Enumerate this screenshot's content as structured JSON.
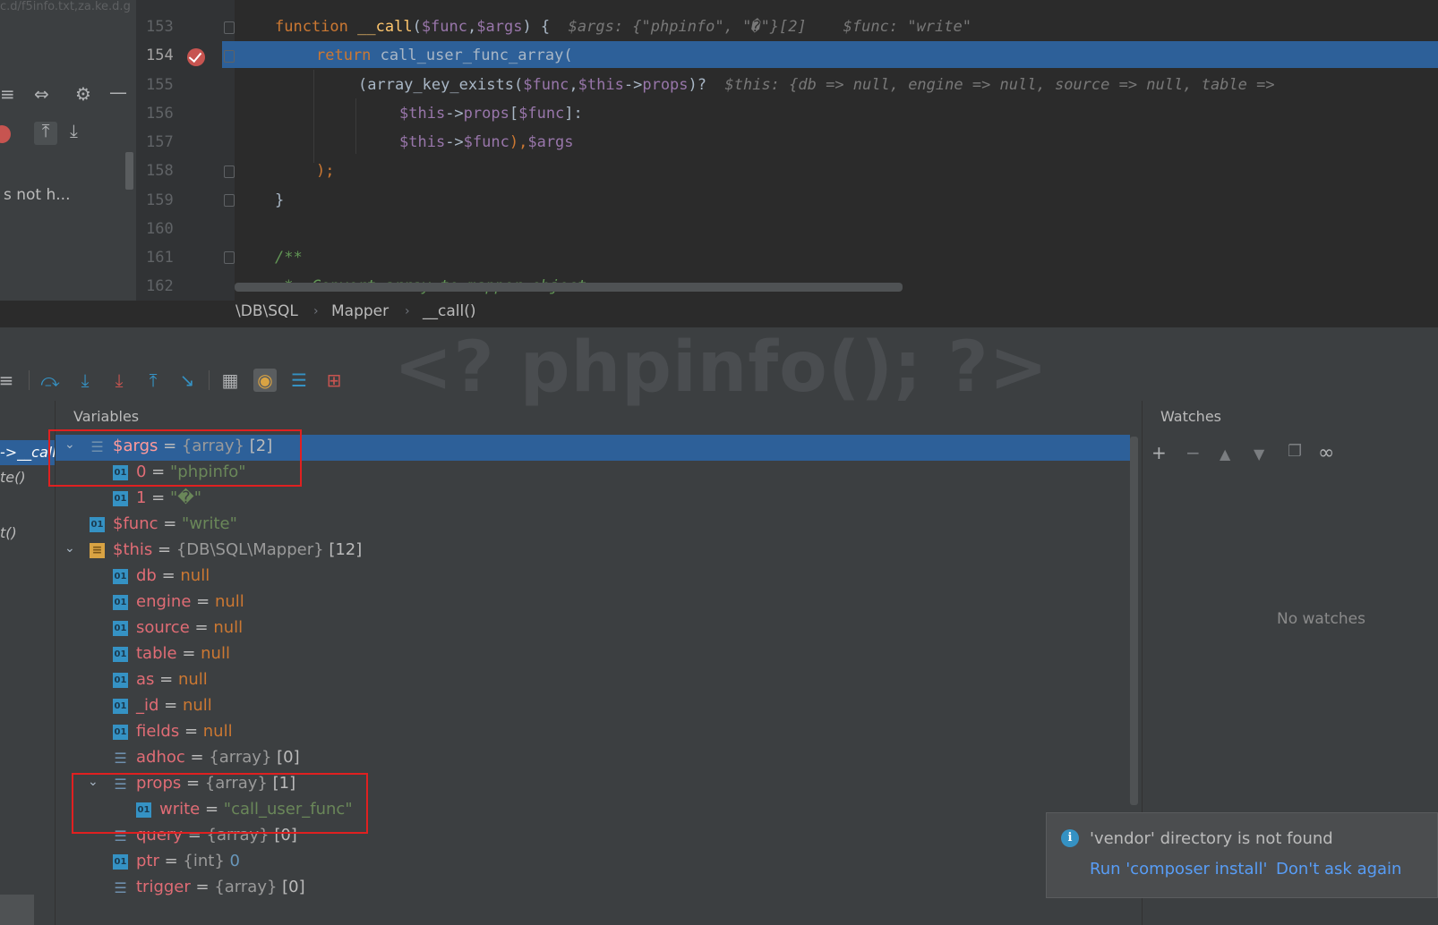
{
  "editor": {
    "lines": [
      {
        "num": "153"
      },
      {
        "num": "154"
      },
      {
        "num": "155"
      },
      {
        "num": "156"
      },
      {
        "num": "157"
      },
      {
        "num": "158"
      },
      {
        "num": "159"
      },
      {
        "num": "160"
      },
      {
        "num": "161"
      },
      {
        "num": "162"
      }
    ],
    "code": {
      "l153_kw": "function",
      "l153_fn": "__call",
      "l153_p1": "(",
      "l153_v1": "$func",
      "l153_p2": ",",
      "l153_v2": "$args",
      "l153_p3": ") {",
      "l153_hint": "$args: {\"phpinfo\", \"�\"}[2]    $func: \"write\"",
      "l154_kw": "return",
      "l154_rest": "call_user_func_array(",
      "l155_a": "(array_key_exists(",
      "l155_v1": "$func",
      "l155_b": ",",
      "l155_v2": "$this",
      "l155_c": "->",
      "l155_v3": "props",
      "l155_d": ")?",
      "l155_hint": "$this: {db => null, engine => null, source => null, table =>",
      "l156_v1": "$this",
      "l156_a": "->",
      "l156_v2": "props",
      "l156_b": "[",
      "l156_v3": "$func",
      "l156_c": "]:",
      "l157_v1": "$this",
      "l157_a": "->",
      "l157_v2": "$func",
      "l157_b": "),",
      "l157_v3": "$args",
      "l158": ");",
      "l159": "}",
      "l161": "/**",
      "l162": " *  Convert array to mapper object"
    }
  },
  "left_panel": {
    "path_fragment": "c.d/f5info.txt,za.ke.d.g",
    "hint": "s not h..."
  },
  "breadcrumb": [
    "\\DB\\SQL",
    "Mapper",
    "__call()"
  ],
  "debug": {
    "watermark": "<? phpinfo(); ?>",
    "frames": [
      "->__call",
      "te()",
      "t()"
    ],
    "variables_title": "Variables",
    "watches_title": "Watches",
    "no_watches": "No watches",
    "vars": [
      {
        "name": "$args",
        "eq": " = ",
        "type": "{array}",
        "count": " [2]"
      },
      {
        "name": "0",
        "eq": " = ",
        "value": "\"phpinfo\""
      },
      {
        "name": "1",
        "eq": " = ",
        "value": "\"�\""
      },
      {
        "name": "$func",
        "eq": " = ",
        "value": "\"write\""
      },
      {
        "name": "$this",
        "eq": " = ",
        "type": "{DB\\SQL\\Mapper}",
        "count": " [12]"
      },
      {
        "name": "db",
        "eq": " = ",
        "value": "null"
      },
      {
        "name": "engine",
        "eq": " = ",
        "value": "null"
      },
      {
        "name": "source",
        "eq": " = ",
        "value": "null"
      },
      {
        "name": "table",
        "eq": " = ",
        "value": "null"
      },
      {
        "name": "as",
        "eq": " = ",
        "value": "null"
      },
      {
        "name": "_id",
        "eq": " = ",
        "value": "null"
      },
      {
        "name": "fields",
        "eq": " = ",
        "value": "null"
      },
      {
        "name": "adhoc",
        "eq": " = ",
        "type": "{array}",
        "count": " [0]"
      },
      {
        "name": "props",
        "eq": " = ",
        "type": "{array}",
        "count": " [1]"
      },
      {
        "name": "write",
        "eq": " = ",
        "value": "\"call_user_func\""
      },
      {
        "name": "query",
        "eq": " = ",
        "type": "{array}",
        "count": " [0]"
      },
      {
        "name": "ptr",
        "eq": " = ",
        "type": "{int}",
        "value": "0"
      },
      {
        "name": "trigger",
        "eq": " = ",
        "type": "{array}",
        "count": " [0]"
      }
    ]
  },
  "notification": {
    "message": "'vendor' directory is not found",
    "action1": "Run 'composer install'",
    "action2": "Don't ask again"
  },
  "colors": {
    "selection": "#2d6099",
    "highlight_box": "#e02020"
  }
}
